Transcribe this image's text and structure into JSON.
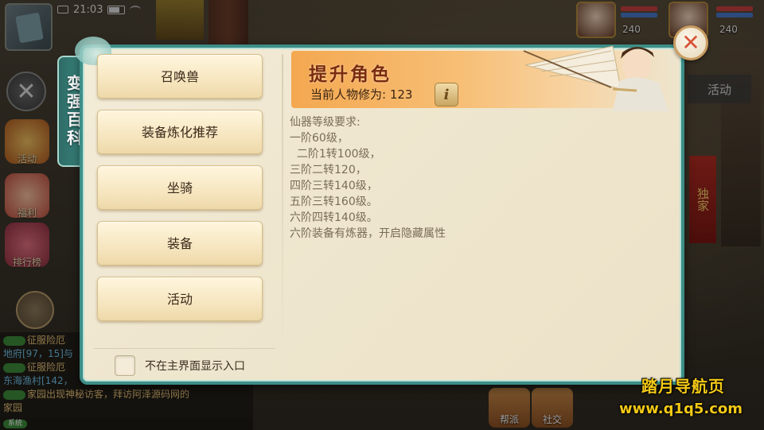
{
  "status_bar": {
    "time": "21:03"
  },
  "dialog": {
    "side_tab_label": "变强百科",
    "menu_items": [
      {
        "label": "召唤兽"
      },
      {
        "label": "装备炼化推荐"
      },
      {
        "label": "坐骑"
      },
      {
        "label": "装备"
      },
      {
        "label": "活动"
      }
    ],
    "checkbox_label": "不在主界面显示入口",
    "banner": {
      "title": "提升角色",
      "subtitle": "当前人物修为: 123"
    },
    "content_lines": [
      "仙器等级要求:",
      "一阶60级，",
      "  二阶1转100级，",
      "三阶二转120，",
      "四阶三转140级，",
      "五阶三转160级。",
      "六阶四转140级。",
      "六阶装备有炼器，开启隐藏属性"
    ]
  },
  "background": {
    "left_buttons": [
      "活动",
      "福利",
      "排行榜"
    ],
    "right_activity": "活动",
    "right_banner": "独家",
    "party_levels": [
      "240",
      "240"
    ],
    "chat_lines": [
      {
        "tag": "",
        "text": "征服险厄"
      },
      {
        "tag": "",
        "text": "地府[97，15]与"
      },
      {
        "tag": "",
        "text": "征服险厄"
      },
      {
        "tag": "",
        "text": "东海渔村[142，"
      },
      {
        "tag": "",
        "text": "家园出现神秘访客，拜访阿泽源码网的"
      },
      {
        "tag": "",
        "text": "家园"
      }
    ],
    "bottom_tag": "系统",
    "bottom_icons": [
      "帮派",
      "社交"
    ]
  },
  "watermark": {
    "title": "踏月导航页",
    "url": "www.q1q5.com"
  },
  "colors": {
    "dialog_border": "#3c8e87",
    "banner_orange": "#f4a850",
    "watermark_yellow": "#f3c916",
    "close_x": "#d8533a"
  }
}
